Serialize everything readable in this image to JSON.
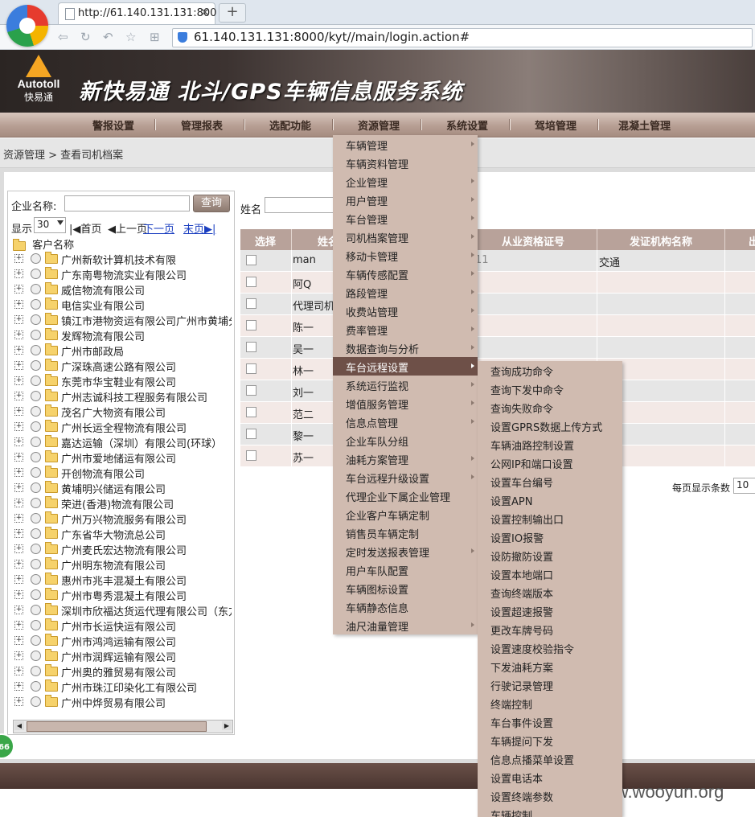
{
  "browser": {
    "tab_title": "http://61.140.131.131:800",
    "url": "61.140.131.131:8000/kyt//main/login.action#"
  },
  "header": {
    "logo_en": "Autotoll",
    "logo_cn": "快易通",
    "system_title": "新快易通 北斗/GPS车辆信息服务系统"
  },
  "nav": [
    {
      "label": "警报设置"
    },
    {
      "label": "管理报表"
    },
    {
      "label": "选配功能"
    },
    {
      "label": "资源管理"
    },
    {
      "label": "系统设置"
    },
    {
      "label": "驾培管理"
    },
    {
      "label": "混凝土管理"
    }
  ],
  "breadcrumb": "资源管理 > 查看司机档案",
  "left": {
    "company_label": "企业名称:",
    "query_button": "查询",
    "show_label": "显示",
    "page_size": "30",
    "first": "|◀首页",
    "prev": "◀上一页",
    "next": "下一页",
    "last": "末页▶|",
    "root": "客户名称",
    "companies": [
      "广州新软计算机技术有限",
      "广东南粤物流实业有限公司",
      "威信物流有限公司",
      "电信实业有限公司",
      "镇江市港物资运有限公司广州市黄埔分公",
      "发辉物流有限公司",
      "广州市邮政局",
      "广深珠高速公路有限公司",
      "东莞市华宝鞋业有限公司",
      "广州志诚科技工程服务有限公司",
      "茂名广大物资有限公司",
      "广州长运全程物流有限公司",
      "嘉达运输（深圳）有限公司(环球）",
      "广州市爱地储运有限公司",
      "开创物流有限公司",
      "黄埔明兴储运有限公司",
      "荣进(香港)物流有限公司",
      "广州万兴物流服务有限公司",
      "广东省华大物流总公司",
      "广州麦氏宏达物流有限公司",
      "广州明东物流有限公司",
      "惠州市兆丰混凝土有限公司",
      "广州市粤秀混凝土有限公司",
      "深圳市欣福达货运代理有限公司（东方福",
      "广州市长运快运有限公司",
      "广州市鸿鸿运输有限公司",
      "广州市润辉运输有限公司",
      "广州奥的雅贸易有限公司",
      "广州市珠江印染化工有限公司",
      "广州中烨贸易有限公司"
    ]
  },
  "table": {
    "name_label": "姓名",
    "headers": [
      "选择",
      "姓名",
      "从业资格证号",
      "发证机构名称",
      "出"
    ],
    "rows": [
      {
        "name": "man",
        "cert": "11",
        "org": "交通"
      },
      {
        "name": "阿Q",
        "cert": "",
        "org": ""
      },
      {
        "name": "代理司机",
        "cert": "",
        "org": ""
      },
      {
        "name": "陈一",
        "cert": "",
        "org": ""
      },
      {
        "name": "吴一",
        "cert": "",
        "org": ""
      },
      {
        "name": "林一",
        "cert": "",
        "org": ""
      },
      {
        "name": "刘一",
        "cert": "",
        "org": ""
      },
      {
        "name": "范二",
        "cert": "",
        "org": ""
      },
      {
        "name": "黎一",
        "cert": "",
        "org": ""
      },
      {
        "name": "苏一",
        "cert": "",
        "org": ""
      }
    ],
    "per_page_label": "每页显示条数",
    "per_page_value": "10"
  },
  "menu": {
    "items": [
      {
        "label": "车辆管理",
        "sub": true
      },
      {
        "label": "车辆资料管理",
        "sub": false
      },
      {
        "label": "企业管理",
        "sub": true
      },
      {
        "label": "用户管理",
        "sub": true
      },
      {
        "label": "车台管理",
        "sub": true
      },
      {
        "label": "司机档案管理",
        "sub": true
      },
      {
        "label": "移动卡管理",
        "sub": true
      },
      {
        "label": "车辆传感配置",
        "sub": true
      },
      {
        "label": "路段管理",
        "sub": true
      },
      {
        "label": "收费站管理",
        "sub": true
      },
      {
        "label": "费率管理",
        "sub": true
      },
      {
        "label": "数据查询与分析",
        "sub": true
      },
      {
        "label": "车台远程设置",
        "sub": true,
        "active": true
      },
      {
        "label": "系统运行监视",
        "sub": true
      },
      {
        "label": "增值服务管理",
        "sub": true
      },
      {
        "label": "信息点管理",
        "sub": true
      },
      {
        "label": "企业车队分组",
        "sub": false
      },
      {
        "label": "油耗方案管理",
        "sub": true
      },
      {
        "label": "车台远程升级设置",
        "sub": true
      },
      {
        "label": "代理企业下属企业管理",
        "sub": false
      },
      {
        "label": "企业客户车辆定制",
        "sub": false
      },
      {
        "label": "销售员车辆定制",
        "sub": false
      },
      {
        "label": "定时发送报表管理",
        "sub": true
      },
      {
        "label": "用户车队配置",
        "sub": false
      },
      {
        "label": "车辆图标设置",
        "sub": false
      },
      {
        "label": "车辆静态信息",
        "sub": false
      },
      {
        "label": "油尺油量管理",
        "sub": true
      }
    ],
    "submenu": [
      "查询成功命令",
      "查询下发中命令",
      "查询失败命令",
      "设置GPRS数据上传方式",
      "车辆油路控制设置",
      "公网IP和端口设置",
      "设置车台编号",
      "设置APN",
      "设置控制输出口",
      "设置IO报警",
      "设防撤防设置",
      "设置本地端口",
      "查询终端版本",
      "设置超速报警",
      "更改车牌号码",
      "设置速度校验指令",
      "下发油耗方案",
      "行驶记录管理",
      "终端控制",
      "车台事件设置",
      "车辆提问下发",
      "信息点播菜单设置",
      "设置电话本",
      "设置终端参数",
      "车辆控制"
    ]
  },
  "badge": "66",
  "watermark": "www.wooyun.org"
}
